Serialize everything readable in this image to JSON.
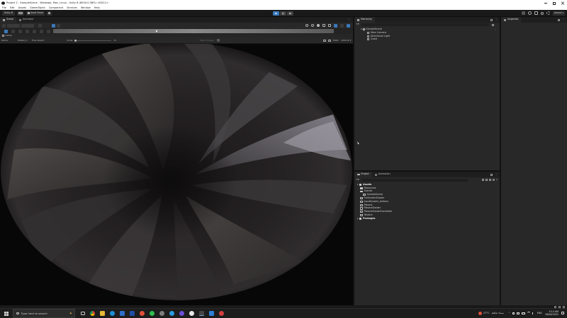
{
  "window": {
    "title": "Project 2 - SampleScene - Windows, Mac, Linux - Unity 6 (6000.0.58f1) <DX11>",
    "controls": [
      "minimize-icon",
      "maximize-icon",
      "close-icon"
    ]
  },
  "menu": [
    "File",
    "Edit",
    "Assets",
    "GameObject",
    "Component",
    "Services",
    "Window",
    "Help"
  ],
  "toolbar": {
    "account": "Unity 6",
    "asset_store": "Asset Store",
    "layout": "Layout"
  },
  "scene_panel": {
    "tabs": [
      "Scene",
      "Animator"
    ],
    "active_tab": "Scene",
    "game_tab": "Game",
    "game_display": "Display 1",
    "game_aspect": "Free Aspect",
    "game_mode": "Game",
    "scale_label": "Scale",
    "scale_value": "1x",
    "play_focused": "Play Focused",
    "stats": "Stats",
    "gizmos": "Gizmos"
  },
  "hierarchy": {
    "tab": "Hierarchy",
    "scene": "SampleScene",
    "items": [
      "Main Camera",
      "Directional Light",
      "Quad"
    ]
  },
  "inspector": {
    "tab": "Inspector"
  },
  "project": {
    "tabs": [
      "Project",
      "Animation"
    ],
    "active_tab": "Project",
    "slider_value": "0",
    "tree": [
      {
        "label": "Assets",
        "depth": 0,
        "bold": true
      },
      {
        "label": "Resources",
        "depth": 1,
        "bold": false
      },
      {
        "label": "Scenes",
        "depth": 1,
        "bold": false
      },
      {
        "label": "SampleScene",
        "depth": 2,
        "bold": false
      },
      {
        "label": "FullScreenShader",
        "depth": 1,
        "bold": false
      },
      {
        "label": "InputSystem_Actions",
        "depth": 1,
        "bold": false
      },
      {
        "label": "Plasma",
        "depth": 1,
        "bold": false
      },
      {
        "label": "PlasmaShader",
        "depth": 1,
        "bold": false
      },
      {
        "label": "PlasmaShaderController",
        "depth": 1,
        "bold": false
      },
      {
        "label": "Texture",
        "depth": 1,
        "bold": false
      },
      {
        "label": "Packages",
        "depth": 0,
        "bold": true
      }
    ]
  },
  "taskbar": {
    "search_placeholder": "Type here to search",
    "weather": "27°C",
    "weather_text": "سماء صافية",
    "language": "ENG",
    "time": "5:14 AM",
    "date": "26/06/2025"
  },
  "colors": {
    "editor_bg": "#282828",
    "accent_blue": "#3a79bb",
    "play_active": "#3a79bb"
  }
}
